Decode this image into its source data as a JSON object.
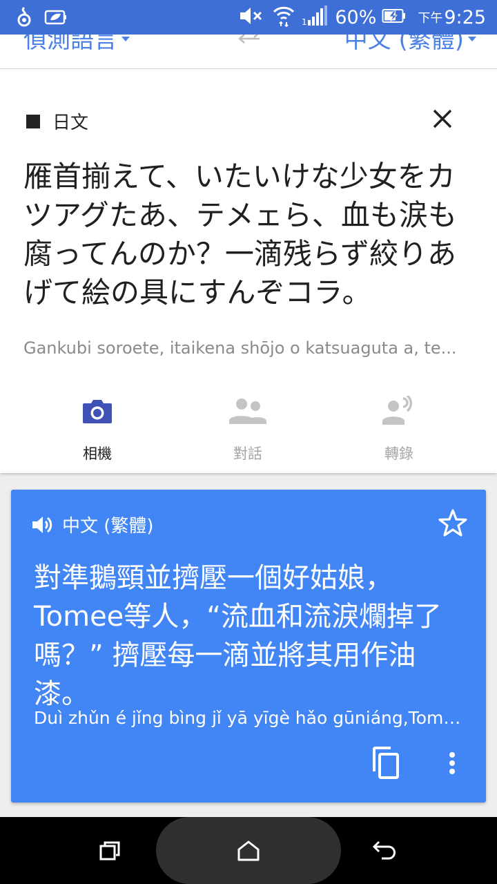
{
  "status_bar": {
    "battery_percent": "60%",
    "ampm": "下午",
    "time": "9:25"
  },
  "language_bar": {
    "source_language": "偵測語言",
    "target_language": "中文 (繁體)"
  },
  "source": {
    "language_label": "日文",
    "text": "雁首揃えて、いたいけな少女をカツアグたあ、テメェら、血も涙も腐ってんのか？一滴残らず絞りあげて絵の具にすんぞコラ。",
    "transliteration": "Gankubi soroete, itaikena shōjo o katsuaguta a, te..."
  },
  "tools": [
    {
      "label": "相機",
      "icon": "camera-icon",
      "active": true
    },
    {
      "label": "對話",
      "icon": "conversation-icon",
      "active": false
    },
    {
      "label": "轉錄",
      "icon": "transcribe-icon",
      "active": false
    }
  ],
  "translation": {
    "language_label": "中文 (繁體)",
    "text": "對準鵝頸並擠壓一個好姑娘，Tomee等人，“流血和流淚爛掉了嗎？” 擠壓每一滴並將其用作油漆。",
    "transliteration": "Duì zhǔn é jǐng bìng jǐ yā yīgè hǎo gūniáng,Tome..."
  },
  "colors": {
    "status_bar": "#3d6fd6",
    "accent": "#4285f4",
    "active_tool": "#3f51b5",
    "inactive_tool": "#c4c4c4"
  }
}
